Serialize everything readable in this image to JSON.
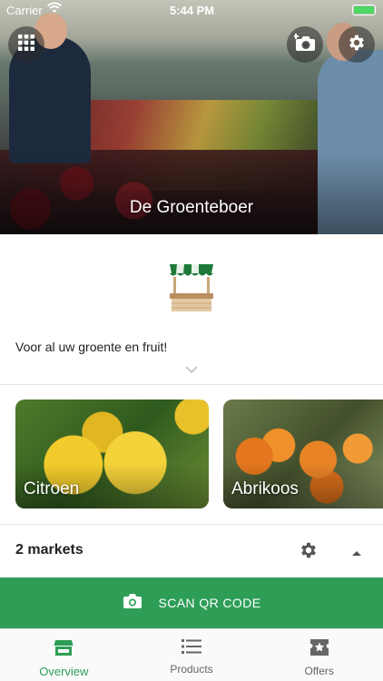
{
  "status_bar": {
    "carrier": "Carrier",
    "time": "5:44 PM"
  },
  "hero": {
    "title": "De Groenteboer"
  },
  "header_icons": [
    "grid-menu-icon",
    "add-photo-icon",
    "gear-icon"
  ],
  "description": {
    "text": "Voor al uw groente en fruit!"
  },
  "products": [
    {
      "name": "Citroen"
    },
    {
      "name": "Abrikoos"
    }
  ],
  "markets": {
    "title": "2 markets"
  },
  "scan": {
    "label": "SCAN QR CODE"
  },
  "tabs": [
    {
      "label": "Overview",
      "icon": "store-icon",
      "active": true
    },
    {
      "label": "Products",
      "icon": "list-icon",
      "active": false
    },
    {
      "label": "Offers",
      "icon": "offer-star-icon",
      "active": false
    }
  ],
  "colors": {
    "accent": "#2e9e57",
    "tab_inactive": "#666666",
    "battery": "#4cd964"
  }
}
